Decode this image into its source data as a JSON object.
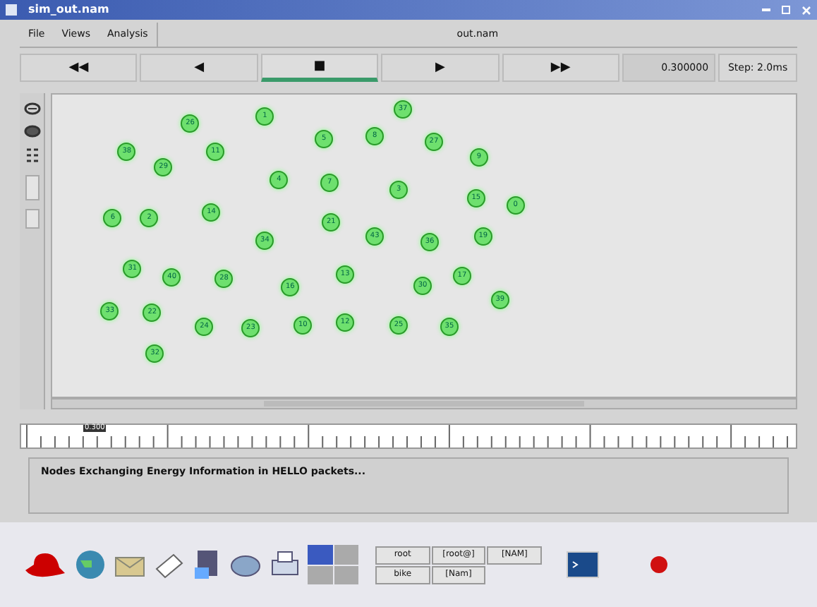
{
  "window": {
    "title": "sim_out.nam"
  },
  "menu": [
    "File",
    "Views",
    "Analysis"
  ],
  "file_label": "out.nam",
  "controls": [
    {
      "symbol": "◀◀",
      "selected": false
    },
    {
      "symbol": "◀",
      "selected": false
    },
    {
      "symbol": "■",
      "selected": true
    },
    {
      "symbol": "▶",
      "selected": false
    },
    {
      "symbol": "▶▶",
      "selected": false
    }
  ],
  "time": "0.300000",
  "step": "Step: 2.0ms",
  "nodes": [
    "26",
    "1",
    "5",
    "8",
    "37",
    "27",
    "9",
    "38",
    "29",
    "11",
    "4",
    "7",
    "3",
    "15",
    "0",
    "6",
    "2",
    "14",
    "34",
    "21",
    "43",
    "36",
    "19",
    "31",
    "40",
    "28",
    "16",
    "13",
    "30",
    "17",
    "39",
    "33",
    "22",
    "24",
    "23",
    "10",
    "12",
    "25",
    "35",
    "32"
  ],
  "timeline_marker": "0.300",
  "message": "Nodes Exchanging Energy Information in HELLO packets...",
  "taskbar": {
    "buttons": [
      "root",
      "[root@]",
      "[NAM]",
      "bike",
      "[Nam]"
    ]
  }
}
